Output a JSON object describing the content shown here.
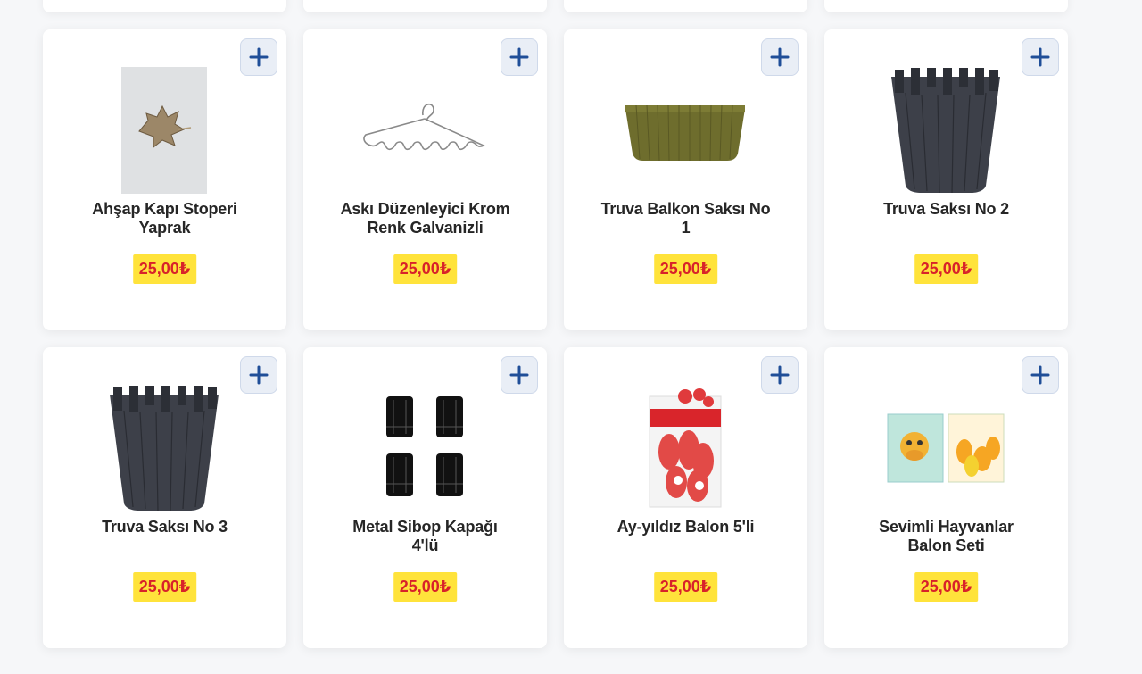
{
  "currency_symbol": "₺",
  "colors": {
    "price_bg": "#ffe33b",
    "price_text": "#d8222a",
    "add_icon": "#1f4e98"
  },
  "products": [
    {
      "name": "Ahşap Kapı Stoperi Yaprak",
      "price": "25,00₺",
      "image": "wooden-leaf-door-stopper"
    },
    {
      "name": "Askı Düzenleyici Krom Renk Galvanizli",
      "price": "25,00₺",
      "image": "chrome-hanger-organizer"
    },
    {
      "name": "Truva Balkon Saksı No 1",
      "price": "25,00₺",
      "image": "olive-balcony-planter"
    },
    {
      "name": "Truva Saksı No 2",
      "price": "25,00₺",
      "image": "dark-slatted-pot"
    },
    {
      "name": "Truva Saksı No 3",
      "price": "25,00₺",
      "image": "dark-slatted-pot"
    },
    {
      "name": "Metal Sibop Kapağı 4'lü",
      "price": "25,00₺",
      "image": "valve-caps-set"
    },
    {
      "name": "Ay-yıldız Balon 5'li",
      "price": "25,00₺",
      "image": "red-flag-balloons-pack"
    },
    {
      "name": "Sevimli Hayvanlar Balon Seti",
      "price": "25,00₺",
      "image": "animal-balloon-packs"
    }
  ]
}
